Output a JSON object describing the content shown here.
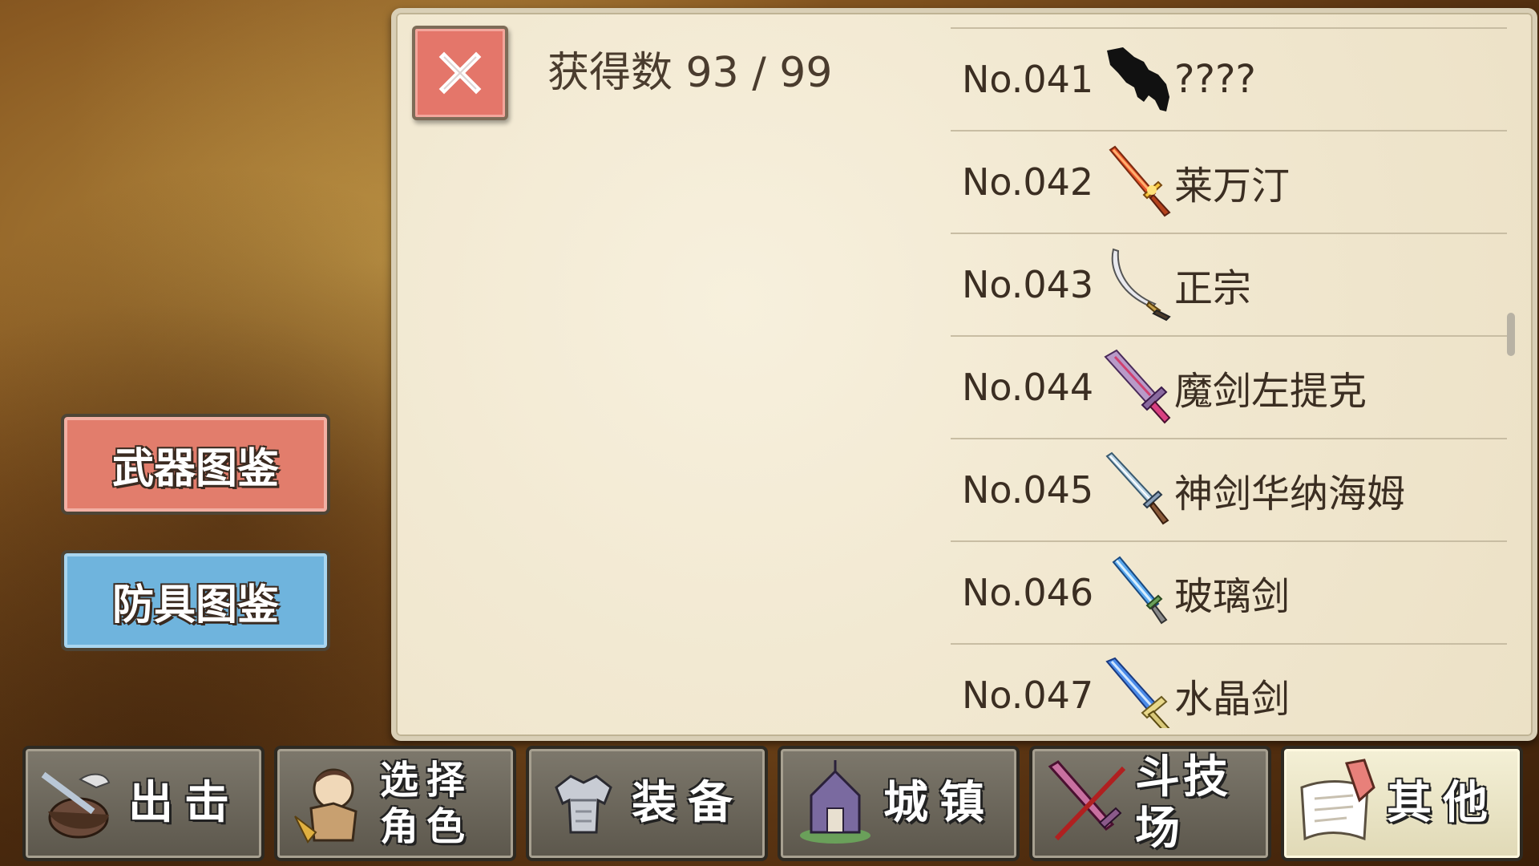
{
  "header": {
    "count_label": "获得数 93 / 99"
  },
  "close_button": {
    "icon": "close-icon",
    "color": "#e4766a"
  },
  "side_tabs": {
    "weapons": {
      "label": "武器图鉴",
      "color": "#e27d6c"
    },
    "armor": {
      "label": "防具图鉴",
      "color": "#6fb4dd"
    }
  },
  "weapon_list": [
    {
      "no": "No.041",
      "name": "????",
      "icon": "unknown-silhouette-icon"
    },
    {
      "no": "No.042",
      "name": "莱万汀",
      "icon": "flame-sword-icon"
    },
    {
      "no": "No.043",
      "name": "正宗",
      "icon": "katana-icon"
    },
    {
      "no": "No.044",
      "name": "魔剑左提克",
      "icon": "demon-sword-icon"
    },
    {
      "no": "No.045",
      "name": "神剑华纳海姆",
      "icon": "holy-sword-icon"
    },
    {
      "no": "No.046",
      "name": "玻璃剑",
      "icon": "glass-sword-icon"
    },
    {
      "no": "No.047",
      "name": "水晶剑",
      "icon": "crystal-sword-icon"
    }
  ],
  "nav": [
    {
      "label": "出击",
      "icon": "sortie-icon"
    },
    {
      "label": "选择角色",
      "line1": "选择",
      "line2": "角色",
      "icon": "character-select-icon"
    },
    {
      "label": "装备",
      "icon": "equipment-icon"
    },
    {
      "label": "城镇",
      "icon": "town-icon"
    },
    {
      "label": "斗技场",
      "icon": "arena-icon"
    },
    {
      "label": "其他",
      "icon": "other-icon",
      "active": true
    }
  ]
}
